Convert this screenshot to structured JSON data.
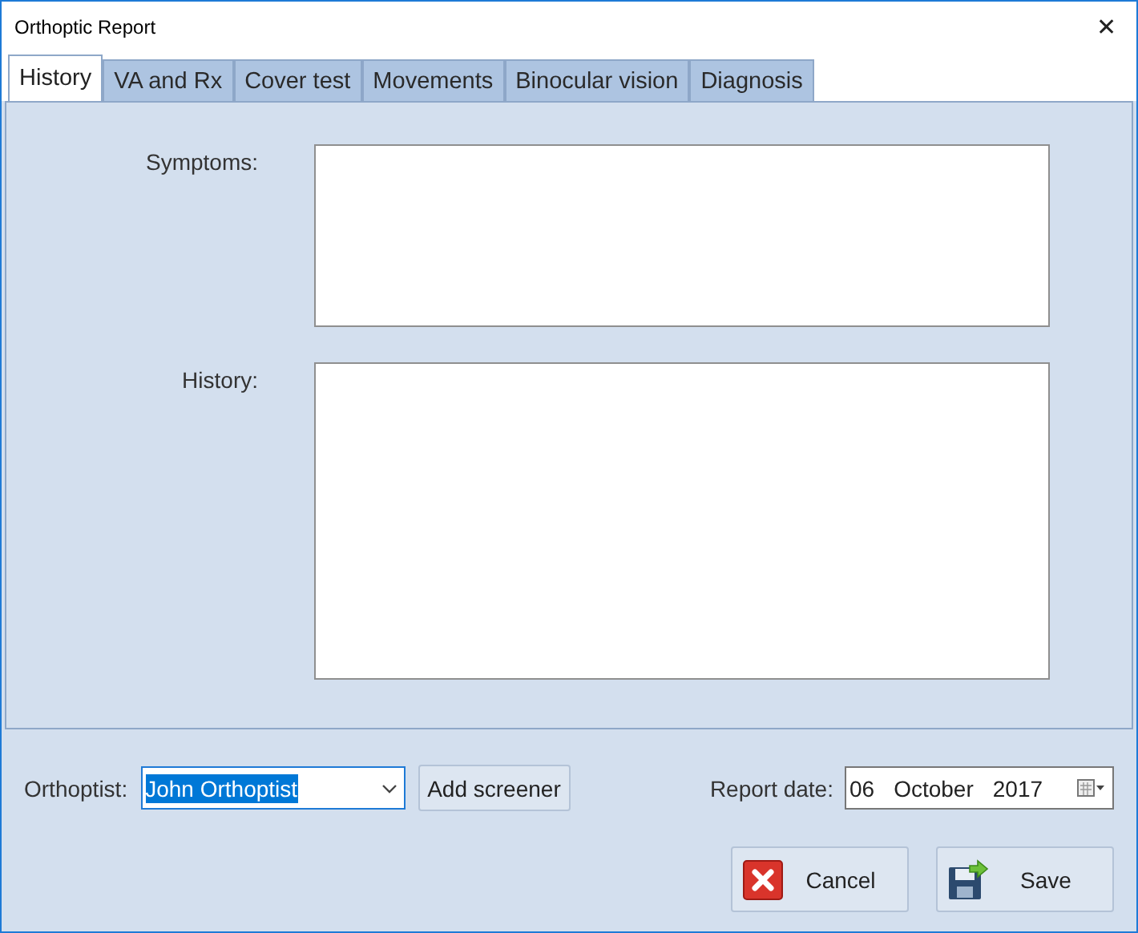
{
  "window": {
    "title": "Orthoptic Report",
    "close": "✕"
  },
  "tabs": [
    {
      "label": "History",
      "selected": true
    },
    {
      "label": "VA and Rx",
      "selected": false
    },
    {
      "label": "Cover test",
      "selected": false
    },
    {
      "label": "Movements",
      "selected": false
    },
    {
      "label": "Binocular vision",
      "selected": false
    },
    {
      "label": "Diagnosis",
      "selected": false
    }
  ],
  "fields": [
    {
      "label": "Symptoms:",
      "kind": "short"
    },
    {
      "label": "History:",
      "kind": "tall"
    }
  ],
  "orthoptist": {
    "label": "Orthoptist:",
    "value": "John Orthoptist",
    "add_button": "Add screener"
  },
  "report_date": {
    "label": "Report date:",
    "day": "06",
    "month": "October",
    "year": "2017"
  },
  "buttons": [
    {
      "label": "Cancel",
      "kind": "cancel"
    },
    {
      "label": "Save",
      "kind": "save"
    }
  ]
}
